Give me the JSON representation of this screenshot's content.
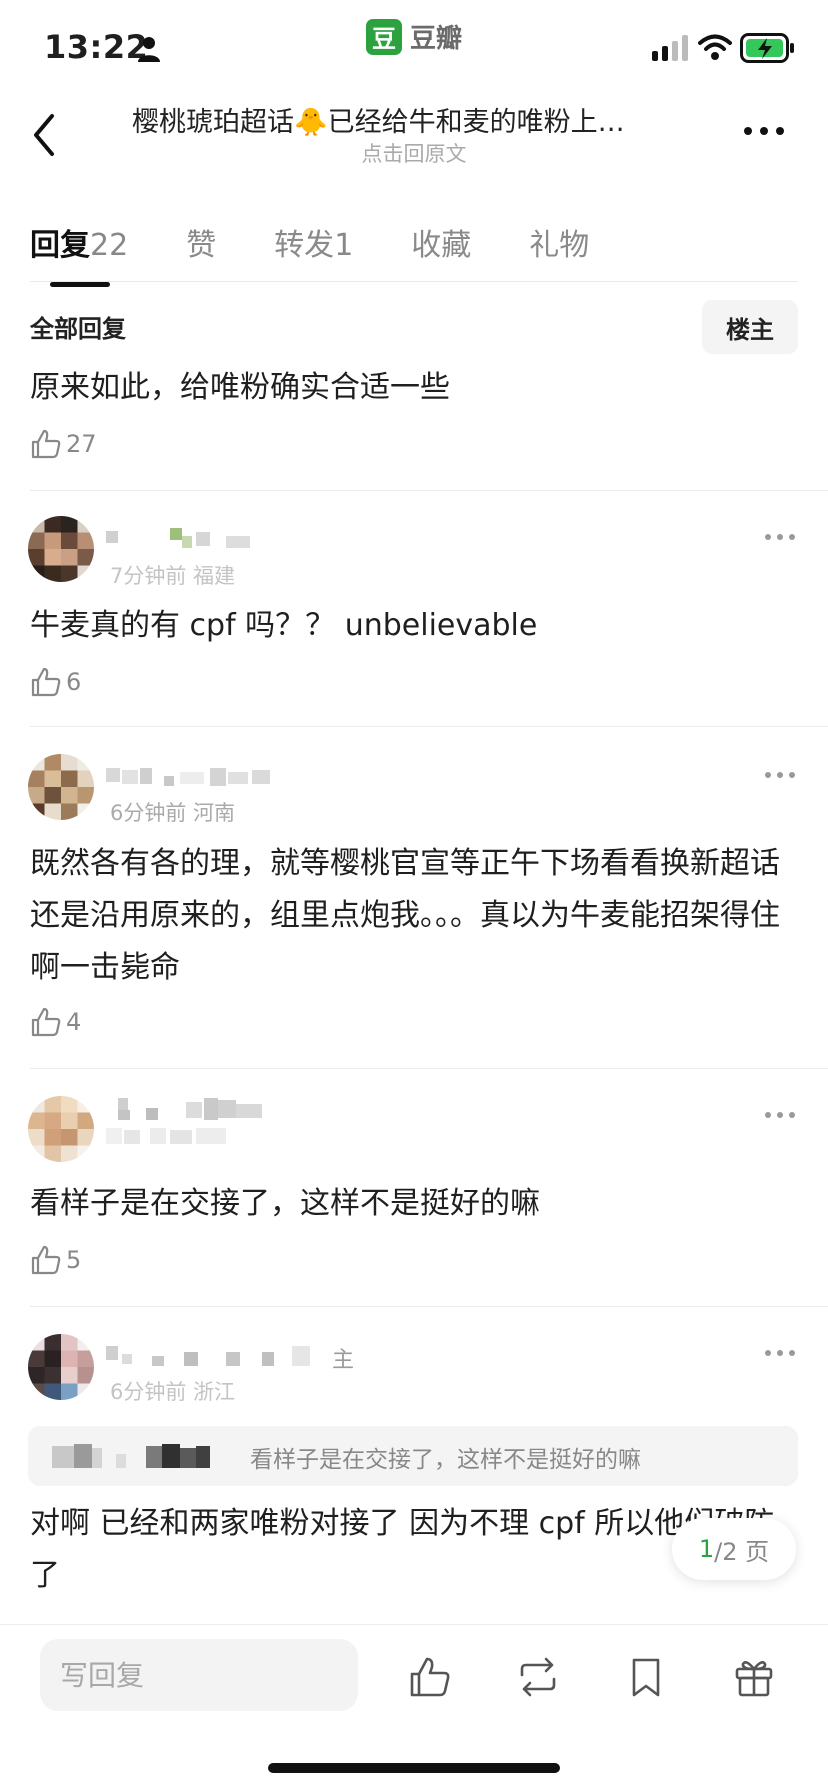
{
  "status_bar": {
    "time": "13:22",
    "app_logo": "豆",
    "app_name": "豆瓣"
  },
  "header": {
    "title": "樱桃琥珀超话🐥已经给牛和麦的唯粉上…",
    "subtitle": "点击回原文"
  },
  "tabs": [
    {
      "label": "回复",
      "count": "22"
    },
    {
      "label": "赞",
      "count": ""
    },
    {
      "label": "转发",
      "count": "1"
    },
    {
      "label": "收藏",
      "count": ""
    },
    {
      "label": "礼物",
      "count": ""
    }
  ],
  "filter": {
    "title": "全部回复",
    "op_button": "楼主"
  },
  "comments": [
    {
      "text": "原来如此，给唯粉确实合适一些",
      "likes": "27"
    },
    {
      "meta": "7分钟前 福建",
      "text": "牛麦真的有 cpf 吗？？ unbelievable",
      "likes": "6"
    },
    {
      "meta": "6分钟前 河南",
      "text": "既然各有各的理，就等樱桃官宣等正午下场看看换新超话还是沿用原来的，组里点炮我。。。真以为牛麦能招架得住啊一击毙命",
      "likes": "4"
    },
    {
      "meta": "",
      "text": "看样子是在交接了，这样不是挺好的嘛",
      "likes": "5"
    },
    {
      "meta": "6分钟前 浙江",
      "badge": "主",
      "quote": "看样子是在交接了，这样不是挺好的嘛",
      "text": "对啊 已经和两家唯粉对接了 因为不理 cpf 所以他们破防了",
      "likes": ""
    }
  ],
  "pager": {
    "current": "1",
    "total": "/2 页"
  },
  "bottom_bar": {
    "reply_placeholder": "写回复"
  },
  "icons": [
    "person-icon",
    "signal-icon",
    "wifi-icon",
    "battery-icon",
    "back-icon",
    "more-icon",
    "thumb-up-icon",
    "dots-icon",
    "repost-icon",
    "bookmark-icon",
    "gift-icon"
  ],
  "colors": {
    "accent": "#2ca23f",
    "battery": "#34c759"
  }
}
